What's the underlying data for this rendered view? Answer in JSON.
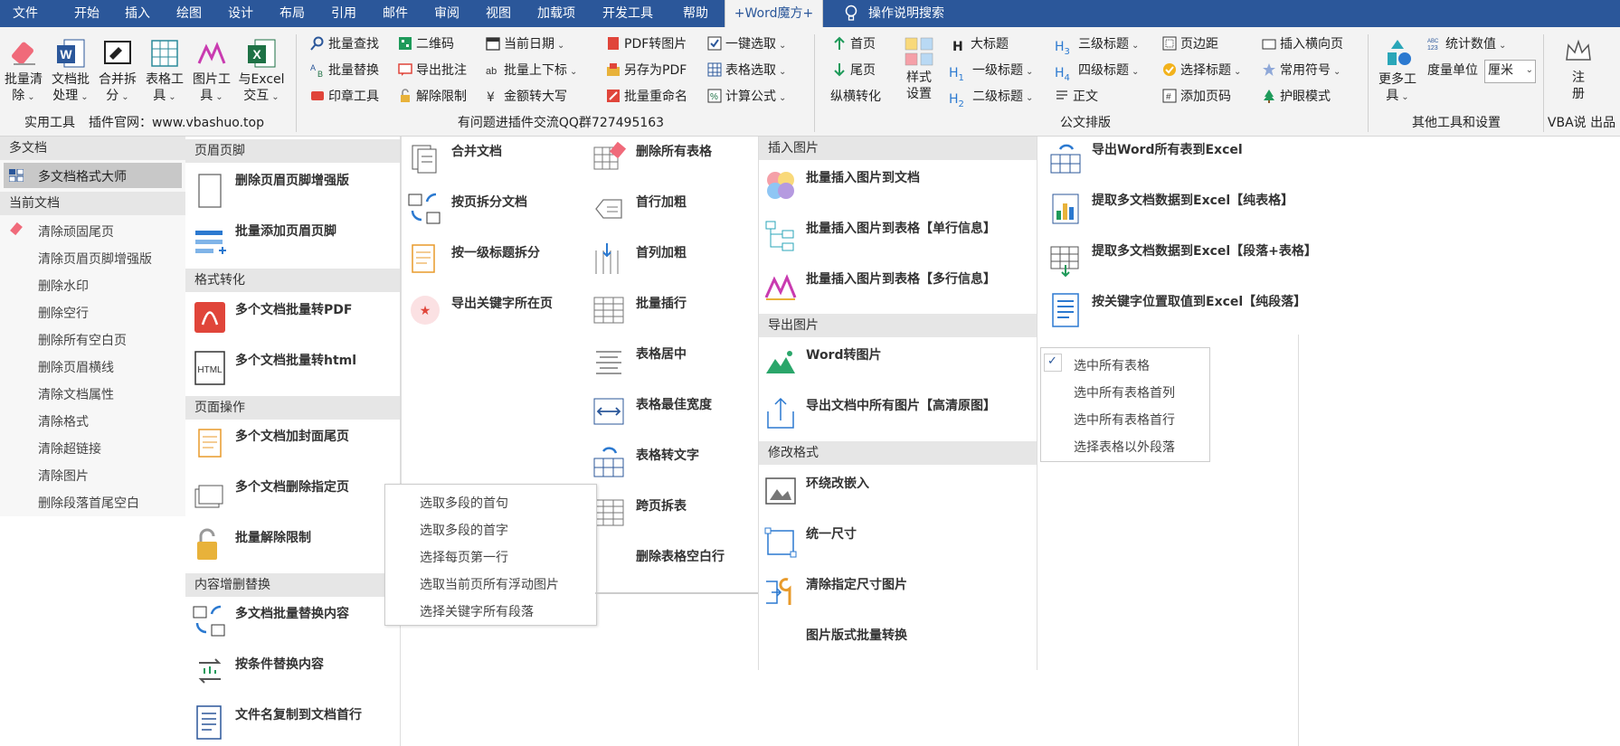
{
  "tabs": [
    "文件",
    "开始",
    "插入",
    "绘图",
    "设计",
    "布局",
    "引用",
    "邮件",
    "审阅",
    "视图",
    "加载项",
    "开发工具",
    "帮助",
    "+Word魔方+"
  ],
  "tell_me": "操作说明搜索",
  "ribbon": {
    "big_buttons": [
      {
        "l1": "批量清",
        "l2": "除"
      },
      {
        "l1": "文档批",
        "l2": "处理"
      },
      {
        "l1": "合并拆",
        "l2": "分"
      },
      {
        "l1": "表格工",
        "l2": "具"
      },
      {
        "l1": "图片工",
        "l2": "具"
      },
      {
        "l1": "与Excel",
        "l2": "交互"
      }
    ],
    "group_practical": "实用工具",
    "website": "插件官网：www.vbashuo.top",
    "col1": [
      "批量查找",
      "批量替换",
      "印章工具"
    ],
    "col2": [
      "二维码",
      "导出批注",
      "解除限制"
    ],
    "col3": [
      "当前日期",
      "批量上下标",
      "金额转大写"
    ],
    "col4": [
      "PDF转图片",
      "另存为PDF",
      "批量重命名"
    ],
    "col5": [
      "一键选取",
      "表格选取",
      "计算公式"
    ],
    "qq_group": "有问题进插件交流QQ群727495163",
    "nav": [
      "首页",
      "尾页",
      "纵横转化"
    ],
    "style_btn": {
      "l1": "样式",
      "l2": "设置"
    },
    "col6": [
      "大标题",
      "一级标题",
      "二级标题"
    ],
    "col7": [
      "三级标题",
      "四级标题",
      "正文"
    ],
    "col8": [
      "页边距",
      "选择标题",
      "添加页码"
    ],
    "group_official": "公文排版",
    "col9": [
      "插入横向页",
      "常用符号",
      "护眼模式"
    ],
    "more": {
      "l1": "更多工",
      "l2": "具"
    },
    "stat": "统计数值",
    "unit_label": "度量单位",
    "unit_value": "厘米",
    "group_other": "其他工具和设置",
    "register": {
      "l1": "注",
      "l2": "册"
    },
    "vba": "VBA说 出品"
  },
  "menu_a": {
    "h1": "多文档",
    "item_master": "多文档格式大师",
    "h2": "当前文档",
    "items": [
      "清除顽固尾页",
      "清除页眉页脚增强版",
      "删除水印",
      "删除空行",
      "删除所有空白页",
      "删除页眉横线",
      "清除文档属性",
      "清除格式",
      "清除超链接",
      "清除图片",
      "删除段落首尾空白"
    ]
  },
  "menu_b": {
    "h_header": "页眉页脚",
    "header_items": [
      "删除页眉页脚增强版",
      "批量添加页眉页脚"
    ],
    "h_convert": "格式转化",
    "convert_items": [
      "多个文档批量转PDF",
      "多个文档批量转html"
    ],
    "h_page": "页面操作",
    "page_items": [
      "多个文档加封面尾页",
      "多个文档删除指定页",
      "批量解除限制"
    ],
    "h_replace": "内容增删替换",
    "replace_items": [
      "多文档批量替换内容",
      "按条件替换内容",
      "文件名复制到文档首行"
    ]
  },
  "menu_c": {
    "items": [
      "合并文档",
      "按页拆分文档",
      "按一级标题拆分",
      "导出关键字所在页"
    ]
  },
  "menu_d": {
    "items": [
      "删除所有表格",
      "首行加粗",
      "首列加粗",
      "批量插行",
      "表格居中",
      "表格最佳宽度",
      "表格转文字",
      "跨页拆表",
      "删除表格空白行"
    ]
  },
  "menu_e": {
    "h_insert": "插入图片",
    "insert_items": [
      "批量插入图片到文档",
      "批量插入图片到表格【单行信息】",
      "批量插入图片到表格【多行信息】"
    ],
    "h_export": "导出图片",
    "export_items": [
      "Word转图片",
      "导出文档中所有图片【高清原图】"
    ],
    "h_modify": "修改格式",
    "modify_items": [
      "环绕改嵌入",
      "统一尺寸",
      "清除指定尺寸图片",
      "图片版式批量转换"
    ]
  },
  "menu_f": {
    "items": [
      "导出Word所有表到Excel",
      "提取多文档数据到Excel【纯表格】",
      "提取多文档数据到Excel【段落+表格】",
      "按关键字位置取值到Excel【纯段落】"
    ]
  },
  "menu_g": {
    "check": "✓",
    "items": [
      "选中所有表格",
      "选中所有表格首列",
      "选中所有表格首行",
      "选择表格以外段落"
    ]
  },
  "menu_h": {
    "items": [
      "选取多段的首句",
      "选取多段的首字",
      "选择每页第一行",
      "选取当前页所有浮动图片",
      "选择关键字所有段落"
    ]
  },
  "colors": {
    "ribbon_blue": "#2b579a",
    "ribbon_bg": "#f3f3f3",
    "header_gray": "#e6e6e6",
    "pdf_red": "#e0453a",
    "excel_green": "#1e7145"
  }
}
